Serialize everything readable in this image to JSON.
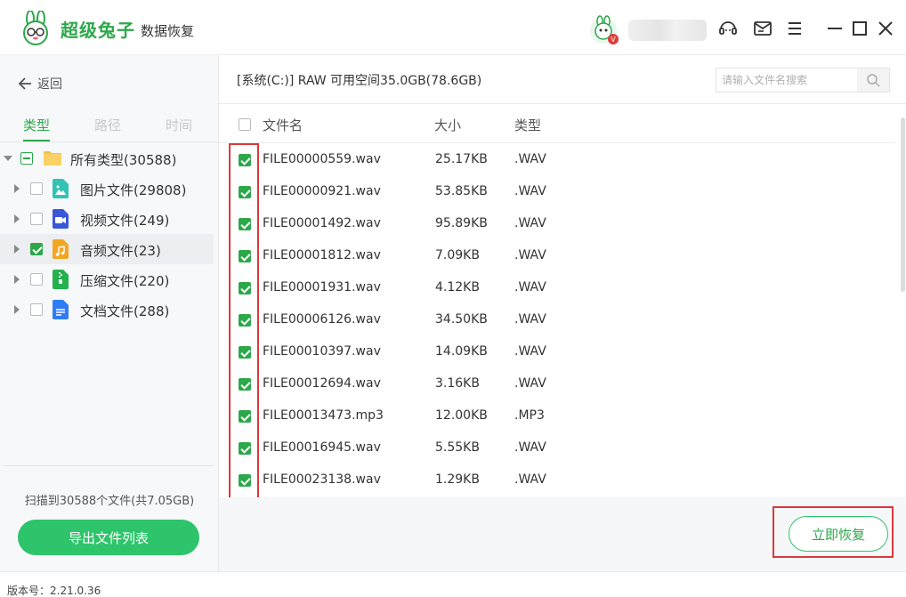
{
  "app": {
    "brand": "超级兔子",
    "subtitle": "数据恢复"
  },
  "window_controls": [
    "support-icon",
    "message-icon",
    "menu-icon",
    "minimize-icon",
    "maximize-icon",
    "close-icon"
  ],
  "sidebar": {
    "back_label": "返回",
    "tabs": [
      {
        "label": "类型",
        "active": true
      },
      {
        "label": "路径",
        "active": false
      },
      {
        "label": "时间",
        "active": false
      }
    ],
    "tree": [
      {
        "label": "所有类型(30588)",
        "icon": "folder-icon",
        "state": "partial",
        "expanded": true
      },
      {
        "label": "图片文件(29808)",
        "icon": "image-file-icon",
        "state": "unchecked"
      },
      {
        "label": "视频文件(249)",
        "icon": "video-file-icon",
        "state": "unchecked"
      },
      {
        "label": "音频文件(23)",
        "icon": "audio-file-icon",
        "state": "checked",
        "selected": true
      },
      {
        "label": "压缩文件(220)",
        "icon": "archive-file-icon",
        "state": "unchecked"
      },
      {
        "label": "文档文件(288)",
        "icon": "document-file-icon",
        "state": "unchecked"
      }
    ],
    "scan_info": "扫描到30588个文件(共7.05GB)",
    "export_label": "导出文件列表"
  },
  "main": {
    "path": "[系统(C:)] RAW 可用空间35.0GB(78.6GB)",
    "search_placeholder": "请输入文件名搜索",
    "columns": [
      "文件名",
      "大小",
      "类型"
    ],
    "files": [
      {
        "name": "FILE00000559.wav",
        "size": "25.17KB",
        "type": ".WAV"
      },
      {
        "name": "FILE00000921.wav",
        "size": "53.85KB",
        "type": ".WAV"
      },
      {
        "name": "FILE00001492.wav",
        "size": "95.89KB",
        "type": ".WAV"
      },
      {
        "name": "FILE00001812.wav",
        "size": "7.09KB",
        "type": ".WAV"
      },
      {
        "name": "FILE00001931.wav",
        "size": "4.12KB",
        "type": ".WAV"
      },
      {
        "name": "FILE00006126.wav",
        "size": "34.50KB",
        "type": ".WAV"
      },
      {
        "name": "FILE00010397.wav",
        "size": "14.09KB",
        "type": ".WAV"
      },
      {
        "name": "FILE00012694.wav",
        "size": "3.16KB",
        "type": ".WAV"
      },
      {
        "name": "FILE00013473.mp3",
        "size": "12.00KB",
        "type": ".MP3"
      },
      {
        "name": "FILE00016945.wav",
        "size": "5.55KB",
        "type": ".WAV"
      },
      {
        "name": "FILE00023138.wav",
        "size": "1.29KB",
        "type": ".WAV"
      }
    ],
    "recover_label": "立即恢复"
  },
  "version": "版本号：2.21.0.36",
  "colors": {
    "accent": "#2ca84a",
    "button_green": "#2ec46b",
    "highlight_red": "#d9393d"
  }
}
